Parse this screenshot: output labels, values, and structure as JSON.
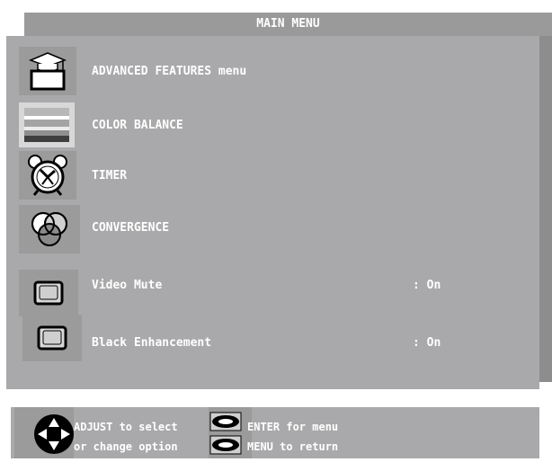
{
  "menu": {
    "title": "MAIN MENU",
    "items": [
      {
        "label": "ADVANCED FEATURES menu",
        "icon": "graduation-cap-icon"
      },
      {
        "label": "COLOR BALANCE",
        "icon": "color-bars-icon"
      },
      {
        "label": "TIMER",
        "icon": "alarm-clock-icon"
      },
      {
        "label": "CONVERGENCE",
        "icon": "convergence-circles-icon"
      },
      {
        "label": "Video Mute",
        "value": ": On",
        "icon": "screen-icon"
      },
      {
        "label": "Black Enhancement",
        "value": ": On",
        "icon": "screen-icon"
      }
    ]
  },
  "help": {
    "adjust_select": "ADJUST to select",
    "change_option": "or change option",
    "enter_menu": "ENTER for menu",
    "menu_return": "MENU to return"
  }
}
